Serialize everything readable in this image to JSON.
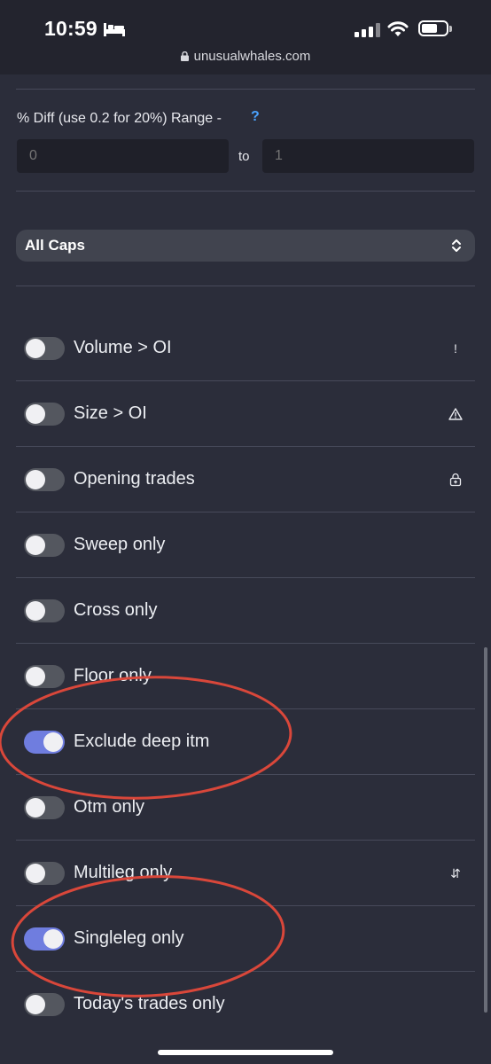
{
  "status_bar": {
    "time": "10:59",
    "url": "unusualwhales.com"
  },
  "diff_range": {
    "label": "% Diff (use 0.2 for 20%) Range -",
    "help": "?",
    "from_placeholder": "0",
    "separator": "to",
    "to_placeholder": "1"
  },
  "cap_select": {
    "selected": "All Caps"
  },
  "filters": [
    {
      "label": "Volume > OI",
      "on": false,
      "icon": "exclamation-icon",
      "glyph": "!"
    },
    {
      "label": "Size > OI",
      "on": false,
      "icon": "warning-icon",
      "glyph": "⚠"
    },
    {
      "label": "Opening trades",
      "on": false,
      "icon": "lock-plus-icon",
      "glyph": ""
    },
    {
      "label": "Sweep only",
      "on": false
    },
    {
      "label": "Cross only",
      "on": false
    },
    {
      "label": "Floor only",
      "on": false
    },
    {
      "label": "Exclude deep itm",
      "on": true
    },
    {
      "label": "Otm only",
      "on": false
    },
    {
      "label": "Multileg only",
      "on": false,
      "icon": "swap-vertical-icon",
      "glyph": "⇵"
    },
    {
      "label": "Singleleg only",
      "on": true
    },
    {
      "label": "Today's trades only",
      "on": false
    }
  ],
  "colors": {
    "background": "#2b2d3a",
    "toggle_on": "#6f7ddf",
    "annotation": "#d9473a",
    "help": "#4aa3ff"
  }
}
